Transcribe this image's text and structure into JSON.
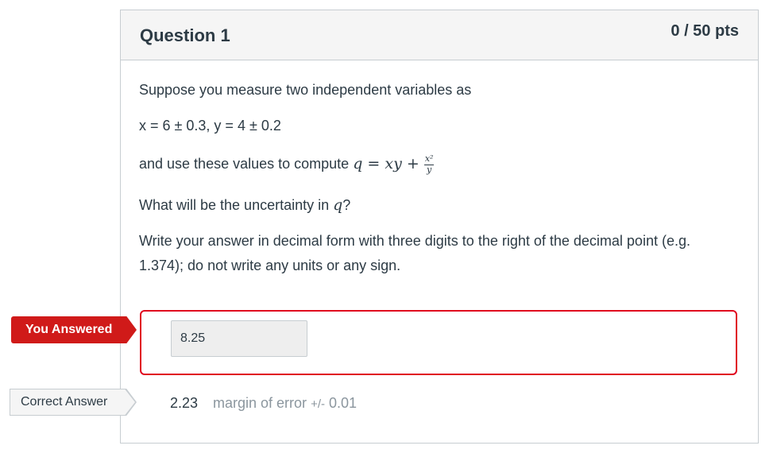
{
  "question": {
    "title": "Question 1",
    "points": "0 / 50 pts",
    "line1": "Suppose you measure two independent variables as",
    "line2": "x = 6 ± 0.3, y = 4 ± 0.2",
    "line3_prefix": "and use these values to compute ",
    "formula_lhs": "q = xy + ",
    "formula_num": "x²",
    "formula_den": "y",
    "line4_prefix": "What will be the uncertainty in ",
    "line4_var": "q",
    "line4_suffix": "?",
    "line5": "Write your answer in decimal form with three digits to the right of the decimal point (e.g. 1.374); do not write any units or any sign."
  },
  "answers": {
    "you_answered_label": "You Answered",
    "your_answer": "8.25",
    "correct_label": "Correct Answer",
    "correct_value": "2.23",
    "margin_label": "margin of error",
    "margin_value": "+/-",
    "margin_amount": "0.01"
  },
  "colors": {
    "incorrect_red": "#e0061f",
    "tag_red": "#d01a19",
    "text": "#2d3b45",
    "muted": "#8b969e"
  }
}
